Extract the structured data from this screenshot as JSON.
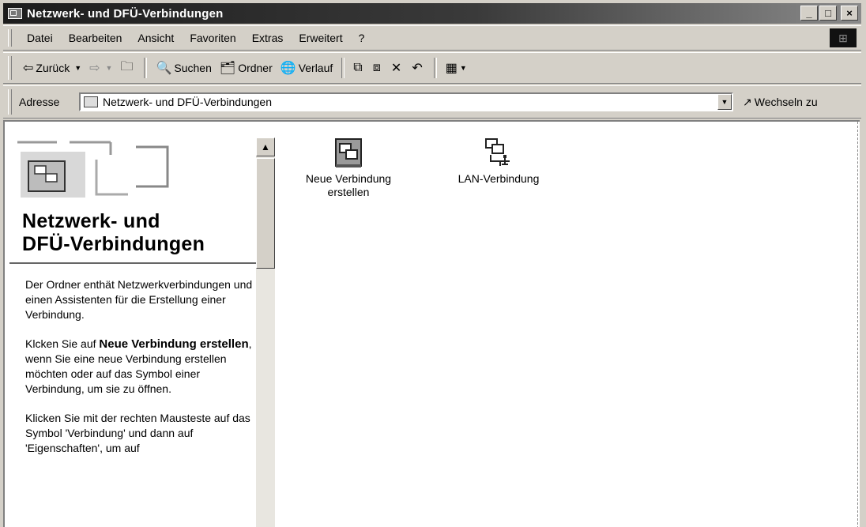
{
  "window": {
    "title": "Netzwerk- und DFÜ-Verbindungen"
  },
  "caption_buttons": {
    "minimize": "_",
    "maximize": "□",
    "close": "×"
  },
  "menubar": {
    "items": [
      "Datei",
      "Bearbeiten",
      "Ansicht",
      "Favoriten",
      "Extras",
      "Erweitert",
      "?"
    ]
  },
  "toolbar": {
    "back": "Zurück",
    "search": "Suchen",
    "folders": "Ordner",
    "history": "Verlauf"
  },
  "address": {
    "label": "Adresse",
    "value": "Netzwerk- und DFÜ-Verbindungen",
    "go_label": "Wechseln zu"
  },
  "left_panel": {
    "title_line1": "Netzwerk- und",
    "title_line2": "DFÜ-Verbindungen",
    "para1": "Der Ordner enthät Netzwerkverbindungen und einen Assistenten für die Erstellung einer Verbindung.",
    "para2_pre": "Klcken Sie auf ",
    "para2_bold": "Neue Verbindung erstellen",
    "para2_post": ", wenn Sie eine neue Verbindung erstellen möchten oder auf das Symbol einer Verbindung, um sie zu öffnen.",
    "para3": "Klicken Sie mit der rechten Mausteste auf das Symbol 'Verbindung' und dann auf 'Eigenschaften', um auf"
  },
  "items": [
    {
      "label_line1": "Neue Verbindung",
      "label_line2": "erstellen",
      "icon": "new-connection-icon"
    },
    {
      "label_line1": "LAN-Verbindung",
      "label_line2": "",
      "icon": "lan-connection-icon"
    }
  ]
}
